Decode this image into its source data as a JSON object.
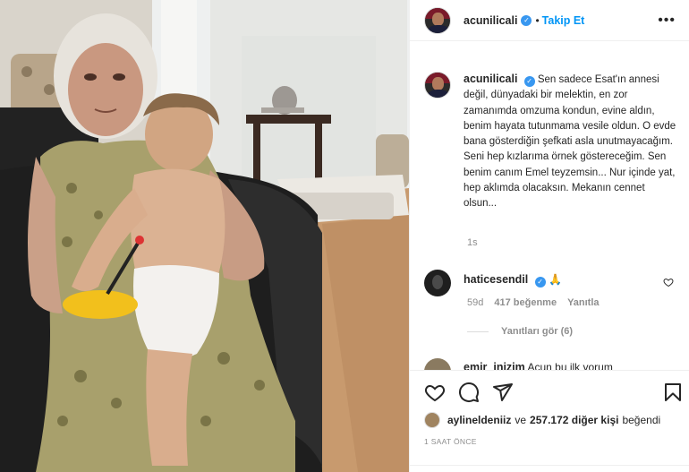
{
  "post": {
    "username": "acunilicali",
    "follow_label": "Takip Et",
    "separator": "•",
    "more_label": "•••",
    "verified_mark": "✓"
  },
  "caption": {
    "username": "acunilicali",
    "text": "Sen sadece Esat'ın annesi değil, dünyadaki bir melektin, en zor zamanımda omzuma kondun, evine aldın, benim hayata tutunmama vesile oldun. O evde bana gösterdiğin şefkati asla unutmayacağım. Seni hep kızlarıma örnek göstereceğim. Sen benim canım Emel teyzemsin... Nur içinde yat, hep aklımda olacaksın. Mekanın cennet olsun...",
    "time": "1s"
  },
  "comments": [
    {
      "username": "haticesendil",
      "emoji": "🙏",
      "time": "59d",
      "likes": "417 beğenme",
      "reply_label": "Yanıtla",
      "view_replies": "Yanıtları gör (6)"
    },
    {
      "username": "emir_inizim",
      "text": "Acun bu ilk yorum"
    }
  ],
  "likes": {
    "user": "aylineldeniiz",
    "connector": "ve",
    "count_text": "257.172 diğer kişi",
    "suffix": "beğendi"
  },
  "posted_ago": "1 SAAT ÖNCE",
  "icons": [
    "heart-icon",
    "comment-icon",
    "share-icon",
    "bookmark-icon",
    "more-icon"
  ],
  "colors": {
    "link_blue": "#0095f6",
    "verified_blue": "#3897f0",
    "muted_gray": "#8e8e8e",
    "text_dark": "#262626"
  }
}
